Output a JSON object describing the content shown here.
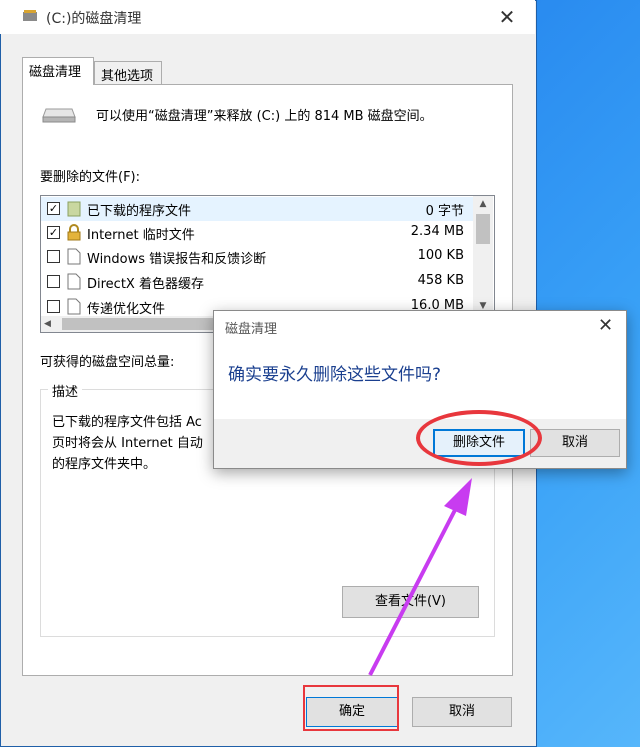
{
  "window": {
    "title": "(C:)的磁盘清理"
  },
  "tabs": [
    {
      "label": "磁盘清理"
    },
    {
      "label": "其他选项"
    }
  ],
  "summary": "可以使用“磁盘清理”来释放 (C:) 上的 814 MB 磁盘空间。",
  "files_label": "要删除的文件(F):",
  "files": [
    {
      "name": "已下载的程序文件",
      "size": "0 字节",
      "checked": true,
      "icon": "folder-icon"
    },
    {
      "name": "Internet 临时文件",
      "size": "2.34 MB",
      "checked": true,
      "icon": "lock-icon"
    },
    {
      "name": "Windows 错误报告和反馈诊断",
      "size": "100 KB",
      "checked": false,
      "icon": "file-icon"
    },
    {
      "name": "DirectX 着色器缓存",
      "size": "458 KB",
      "checked": false,
      "icon": "file-icon"
    },
    {
      "name": "传递优化文件",
      "size": "16.0 MB",
      "checked": false,
      "icon": "file-icon"
    }
  ],
  "gain_label": "可获得的磁盘空间总量:",
  "description": {
    "title": "描述",
    "lines": [
      "已下载的程序文件包括 Ac",
      "页时将会从 Internet 自动",
      "的程序文件夹中。"
    ]
  },
  "buttons": {
    "view_files": "查看文件(V)",
    "ok": "确定",
    "cancel": "取消"
  },
  "dialog": {
    "title": "磁盘清理",
    "message": "确实要永久删除这些文件吗?",
    "delete": "删除文件",
    "cancel": "取消"
  },
  "colors": {
    "accent": "#0078d7",
    "highlight_red": "#e8373d",
    "annotation_arrow": "#c83cf0"
  }
}
